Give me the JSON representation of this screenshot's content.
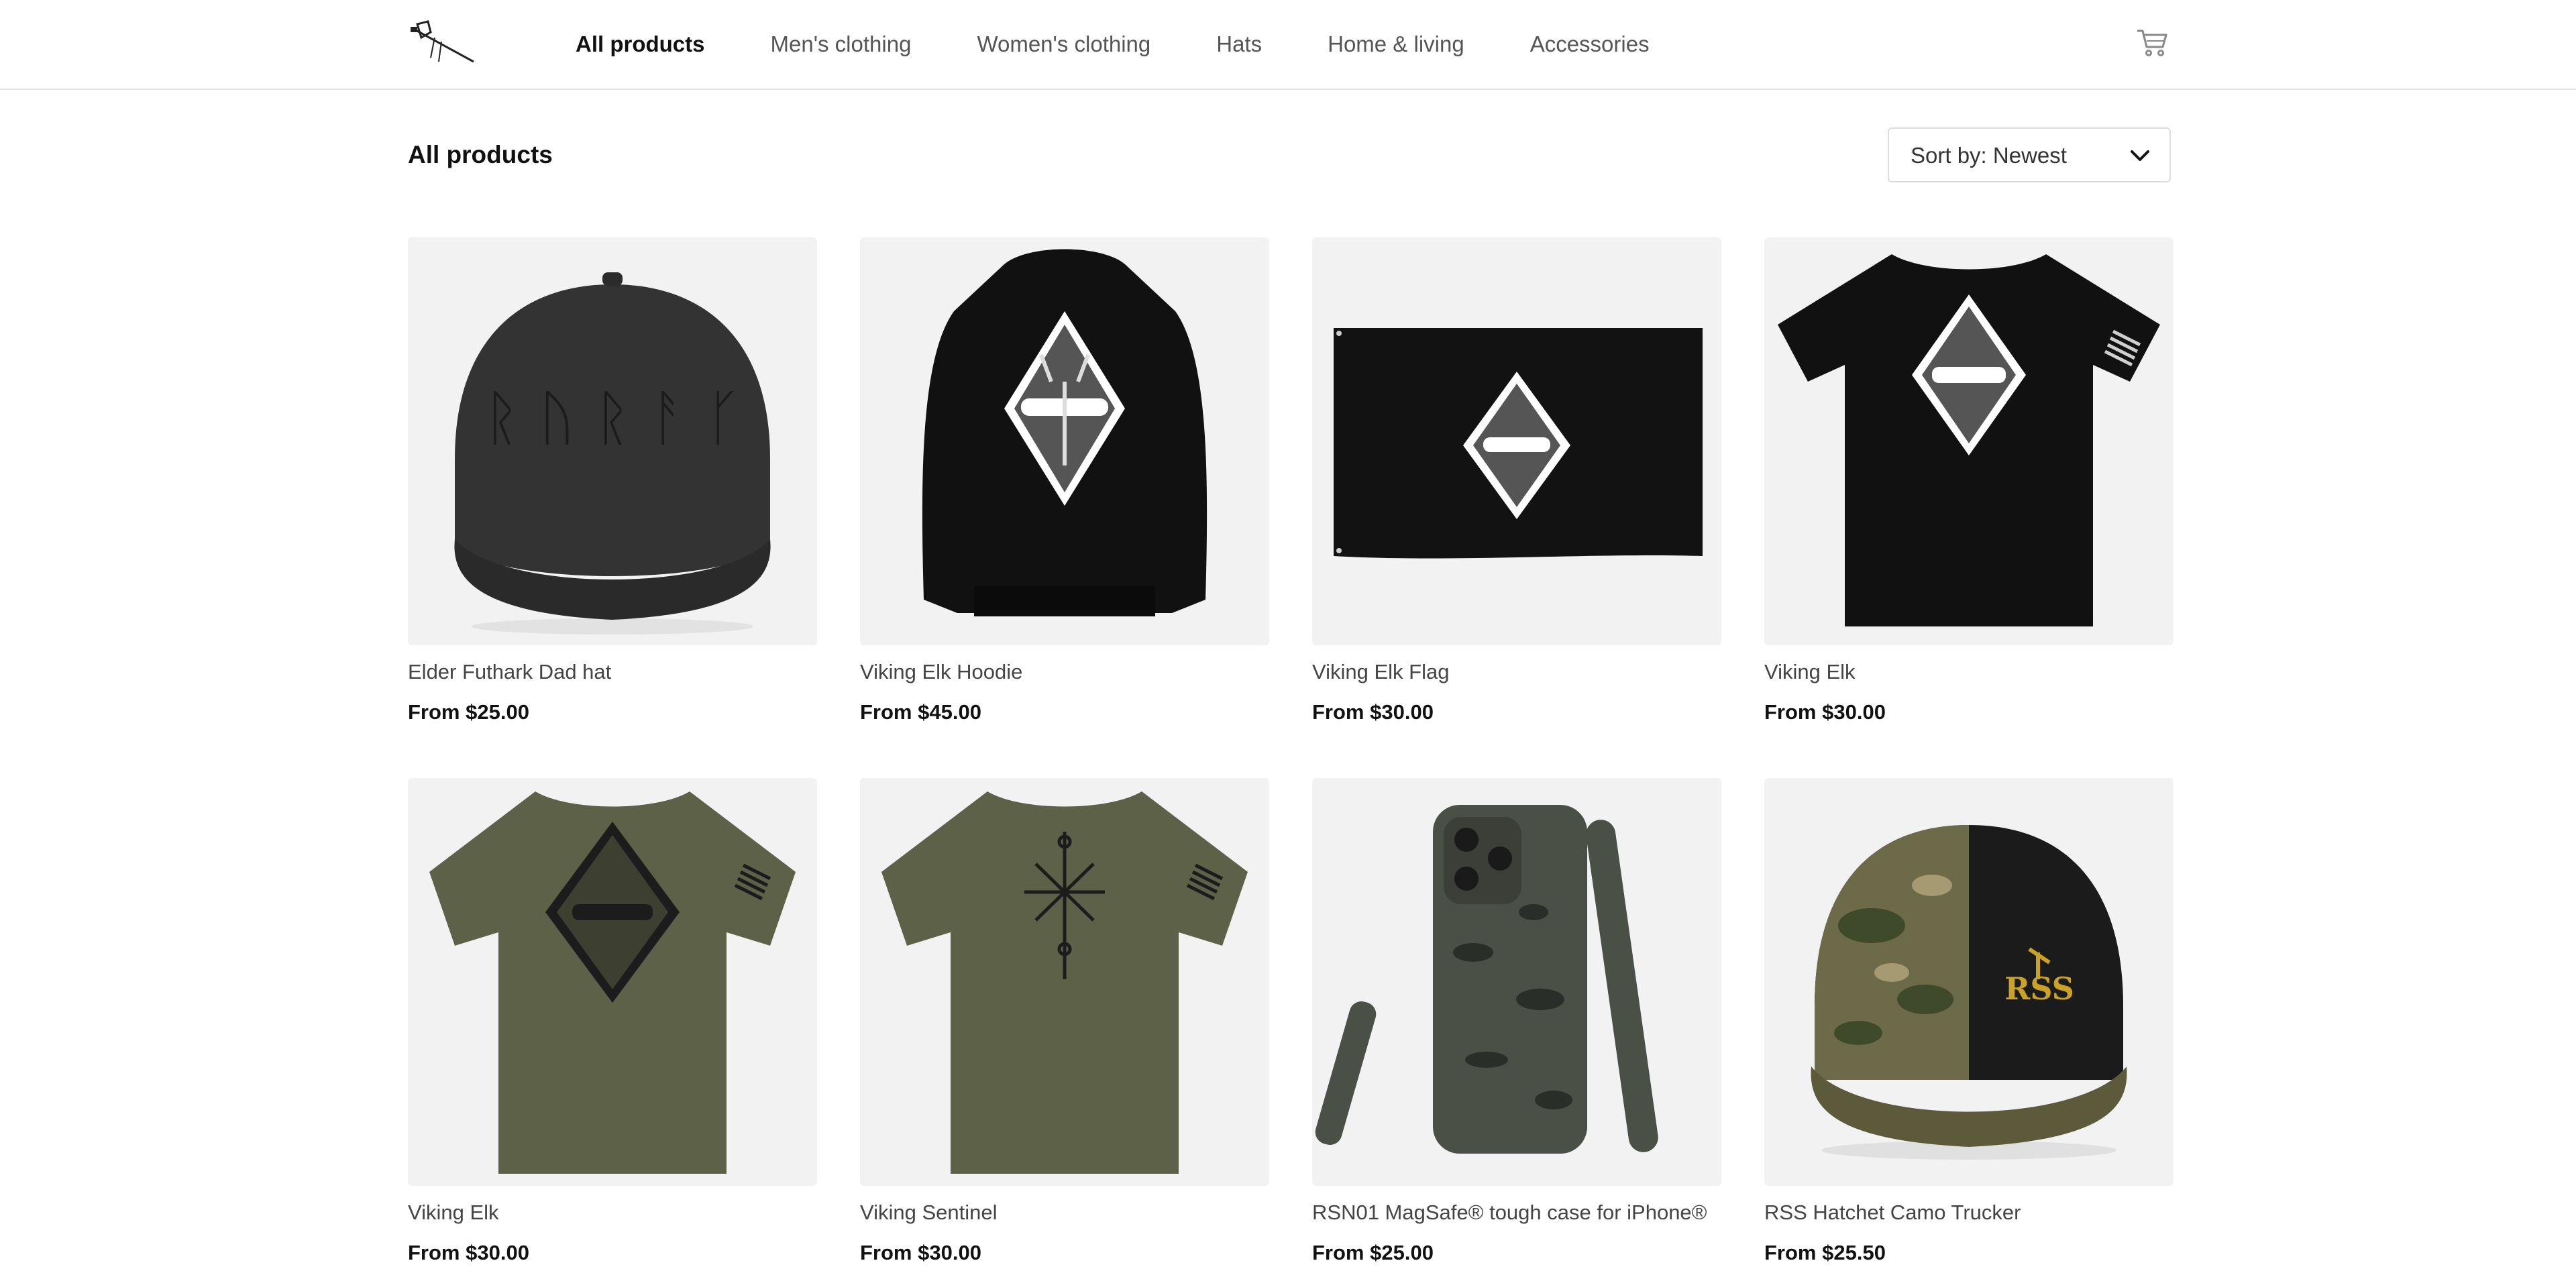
{
  "header": {
    "logo_icon": "hatchet-logo-icon",
    "nav": [
      {
        "label": "All products",
        "active": true
      },
      {
        "label": "Men's clothing",
        "active": false
      },
      {
        "label": "Women's clothing",
        "active": false
      },
      {
        "label": "Hats",
        "active": false
      },
      {
        "label": "Home & living",
        "active": false
      },
      {
        "label": "Accessories",
        "active": false
      }
    ],
    "cart_icon": "cart-icon"
  },
  "main": {
    "title": "All products",
    "sort_label": "Sort by: Newest",
    "sort_icon": "chevron-down-icon"
  },
  "products": [
    {
      "name": "Elder Futhark Dad hat",
      "price": "From $25.00",
      "image": "black-dad-hat"
    },
    {
      "name": "Viking Elk Hoodie",
      "price": "From $45.00",
      "image": "black-hoodie-elk"
    },
    {
      "name": "Viking Elk Flag",
      "price": "From $30.00",
      "image": "black-flag-elk"
    },
    {
      "name": "Viking Elk",
      "price": "From $30.00",
      "image": "black-tshirt-elk"
    },
    {
      "name": "Viking Elk",
      "price": "From $30.00",
      "image": "olive-tshirt-elk"
    },
    {
      "name": "Viking Sentinel",
      "price": "From $30.00",
      "image": "olive-tshirt-sentinel"
    },
    {
      "name": "RSN01 MagSafe® tough case for iPhone®",
      "price": "From $25.00",
      "image": "camo-phone-case"
    },
    {
      "name": "RSS Hatchet Camo Trucker",
      "price": "From $25.50",
      "image": "camo-trucker-hat"
    }
  ],
  "colors": {
    "image_bg": "#f2f2f2",
    "olive": "#5d6147",
    "black_garment": "#111111",
    "hat_gray": "#2f2f2f",
    "logo_gold": "#c9a227"
  }
}
